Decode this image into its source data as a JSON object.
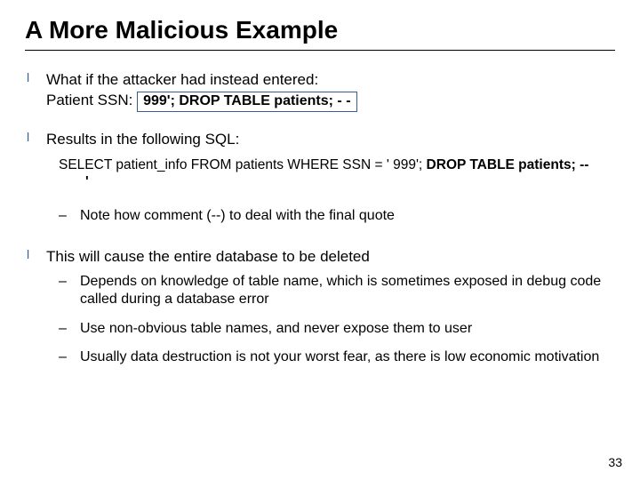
{
  "title": "A More Malicious Example",
  "bullets": {
    "b1_line1": "What if the attacker had instead entered:",
    "b1_ssn_label": "Patient SSN:",
    "b1_ssn_value": " 999'; DROP TABLE patients; - -",
    "b2_line1": "Results in the following SQL:",
    "sql_part1": "SELECT patient_info FROM patients WHERE SSN = ' 999';",
    "sql_part2_bold": " DROP TABLE patients; --",
    "sql_part3": "'",
    "b2_sub1": "Note how comment (--) to deal with the final quote",
    "b3_line1": "This will cause the entire database to be deleted",
    "b3_sub1": "Depends on knowledge of table name, which is sometimes exposed in debug code called during a database error",
    "b3_sub2": "Use non-obvious table names, and never expose them to user",
    "b3_sub3": "Usually data destruction is not your worst fear, as there is low economic motivation"
  },
  "page_number": "33"
}
